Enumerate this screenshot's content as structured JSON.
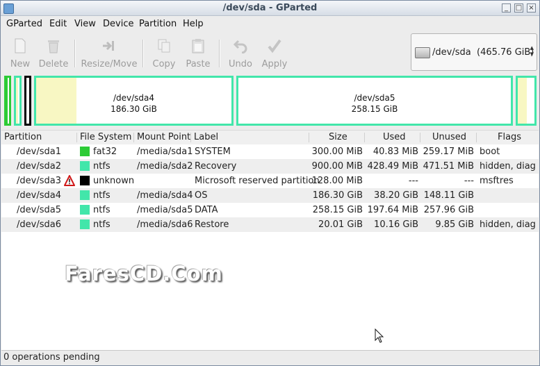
{
  "window": {
    "title": "/dev/sda - GParted"
  },
  "menus": [
    "GParted",
    "Edit",
    "View",
    "Device",
    "Partition",
    "Help"
  ],
  "toolbar": {
    "new": "New",
    "delete": "Delete",
    "resize_move": "Resize/Move",
    "copy": "Copy",
    "paste": "Paste",
    "undo": "Undo",
    "apply": "Apply"
  },
  "device": {
    "name": "/dev/sda",
    "size": "(465.76 GiB)"
  },
  "partition_map": {
    "sda4": {
      "name": "/dev/sda4",
      "size": "186.30 GiB"
    },
    "sda5": {
      "name": "/dev/sda5",
      "size": "258.15 GiB"
    }
  },
  "columns": [
    "Partition",
    "File System",
    "Mount Point",
    "Label",
    "Size",
    "Used",
    "Unused",
    "Flags"
  ],
  "rows": [
    {
      "partition": "/dev/sda1",
      "fs": "fat32",
      "fs_color": "#2ccb35",
      "mount": "/media/sda1",
      "label": "SYSTEM",
      "size": "300.00 MiB",
      "used": "40.83 MiB",
      "unused": "259.17 MiB",
      "flags": "boot"
    },
    {
      "partition": "/dev/sda2",
      "fs": "ntfs",
      "fs_color": "#42e6aa",
      "mount": "/media/sda2",
      "label": "Recovery",
      "size": "900.00 MiB",
      "used": "428.49 MiB",
      "unused": "471.51 MiB",
      "flags": "hidden, diag"
    },
    {
      "partition": "/dev/sda3",
      "fs": "unknown",
      "fs_color": "#000000",
      "mount": "",
      "label": "Microsoft reserved partition",
      "size": "128.00 MiB",
      "used": "---",
      "unused": "---",
      "flags": "msftres"
    },
    {
      "partition": "/dev/sda4",
      "fs": "ntfs",
      "fs_color": "#42e6aa",
      "mount": "/media/sda4",
      "label": "OS",
      "size": "186.30 GiB",
      "used": "38.20 GiB",
      "unused": "148.11 GiB",
      "flags": ""
    },
    {
      "partition": "/dev/sda5",
      "fs": "ntfs",
      "fs_color": "#42e6aa",
      "mount": "/media/sda5",
      "label": "DATA",
      "size": "258.15 GiB",
      "used": "197.64 MiB",
      "unused": "257.96 GiB",
      "flags": ""
    },
    {
      "partition": "/dev/sda6",
      "fs": "ntfs",
      "fs_color": "#42e6aa",
      "mount": "/media/sda6",
      "label": "Restore",
      "size": "20.01 GiB",
      "used": "10.16 GiB",
      "unused": "9.85 GiB",
      "flags": "hidden, diag"
    }
  ],
  "watermark": "FaresCD.Com",
  "status": "0 operations pending",
  "colors": {
    "fat32": "#2ccb35",
    "ntfs": "#42e6aa",
    "unknown": "#000000",
    "used_space": "#f8f7c3"
  }
}
